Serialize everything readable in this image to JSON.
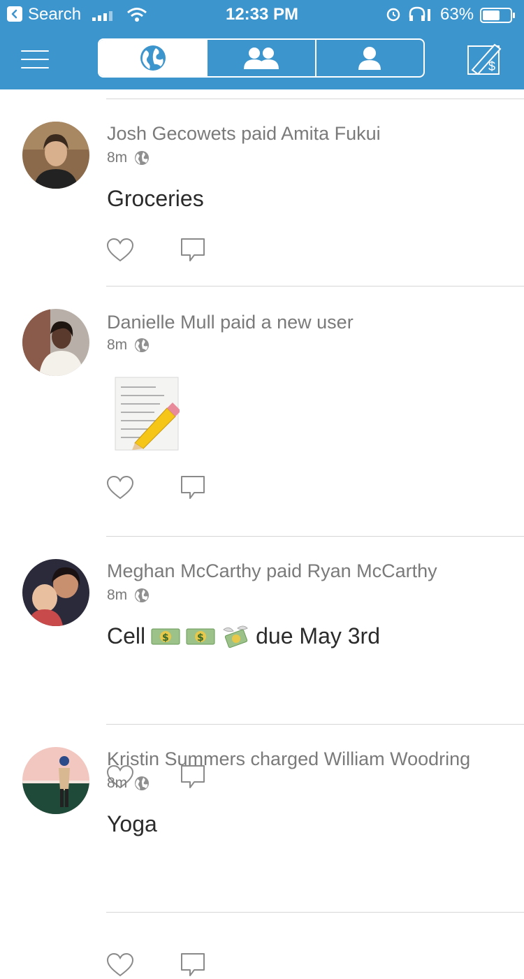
{
  "status_bar": {
    "back_label": "Search",
    "time": "12:33 PM",
    "battery_percent": "63%",
    "battery_level": 0.63
  },
  "nav": {
    "tabs": [
      {
        "name": "public",
        "icon": "globe-icon",
        "active": true
      },
      {
        "name": "friends",
        "icon": "friends-icon",
        "active": false
      },
      {
        "name": "mine",
        "icon": "person-icon",
        "active": false
      }
    ]
  },
  "feed": {
    "stories": [
      {
        "headline": "Josh Gecowets paid Amita Fukui",
        "time": "8m",
        "note": "Groceries",
        "note_type": "text",
        "avatar_colors": [
          "#8a6a4a",
          "#3a2a1e"
        ]
      },
      {
        "headline": "Danielle Mull paid a new user",
        "time": "8m",
        "note": "",
        "note_type": "emoji-memo",
        "avatar_colors": [
          "#b8b0a8",
          "#5a3a2c"
        ]
      },
      {
        "headline": "Meghan McCarthy paid Ryan McCarthy",
        "time": "8m",
        "note": "Cell",
        "note_suffix": "due May 3rd",
        "note_emojis": [
          "dollar-banknote-icon",
          "dollar-banknote-icon",
          "money-with-wings-icon"
        ],
        "note_type": "text-emoji",
        "avatar_colors": [
          "#c84a4a",
          "#2a2a3a"
        ]
      },
      {
        "headline": "Kristin Summers charged William Woodring",
        "time": "8m",
        "note": "Yoga",
        "note_type": "text",
        "avatar_colors": [
          "#f2c7c0",
          "#1f4a3a"
        ]
      }
    ]
  }
}
